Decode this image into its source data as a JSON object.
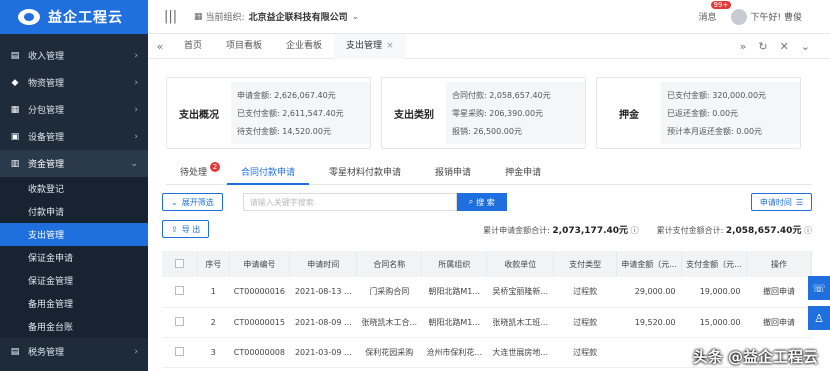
{
  "app": {
    "logo": "益企工程云"
  },
  "sidebar": {
    "groups_top": [
      {
        "label": "收入管理"
      },
      {
        "label": "物资管理"
      },
      {
        "label": "分包管理"
      },
      {
        "label": "设备管理"
      }
    ],
    "active_group": {
      "label": "资金管理"
    },
    "subitems": [
      {
        "label": "收款登记"
      },
      {
        "label": "付款申请"
      },
      {
        "label": "支出管理"
      },
      {
        "label": "保证金申请"
      },
      {
        "label": "保证金管理"
      },
      {
        "label": "备用金管理"
      },
      {
        "label": "备用金台账"
      }
    ],
    "groups_bottom": [
      {
        "label": "税务管理"
      }
    ]
  },
  "topbar": {
    "org_label": "当前组织:",
    "org_name": "北京益企联科技有限公司",
    "msg_label": "消息",
    "msg_badge": "99+",
    "greeting": "下午好! 曹俊"
  },
  "page_tabs": [
    {
      "label": "首页"
    },
    {
      "label": "项目看板"
    },
    {
      "label": "企业看板"
    },
    {
      "label": "支出管理"
    }
  ],
  "cards": [
    {
      "title": "支出概况",
      "lines": [
        "申请金额: 2,626,067.40元",
        "已支付金额: 2,611,547.40元",
        "待支付金额: 14,520.00元"
      ]
    },
    {
      "title": "支出类别",
      "lines": [
        "合同付款: 2,058,657.40元",
        "零星采购: 206,390.00元",
        "报销: 26,500.00元"
      ]
    },
    {
      "title": "押金",
      "lines": [
        "已支付金额: 320,000.00元",
        "已返还金额: 0.00元",
        "预计本月返还金额: 0.00元"
      ]
    }
  ],
  "filter_tabs": [
    {
      "label": "待处理",
      "badge": "2"
    },
    {
      "label": "合同付款申请"
    },
    {
      "label": "零星材料付款申请"
    },
    {
      "label": "报销申请"
    },
    {
      "label": "押金申请"
    }
  ],
  "toolbar": {
    "expand_label": "展开筛选",
    "search_placeholder": "请输入关键字搜索",
    "search_label": "搜 索",
    "time_label": "申请时间",
    "export_label": "导 出",
    "sum_apply_label": "累计申请金额合计:",
    "sum_apply_value": "2,073,177.40元",
    "sum_paid_label": "累计支付金额合计:",
    "sum_paid_value": "2,058,657.40元"
  },
  "table": {
    "headers": [
      "序号",
      "申请编号",
      "申请时间",
      "合同名称",
      "所属组织",
      "收款单位",
      "支付类型",
      "申请金额（元...",
      "支付金额（元...",
      "操作"
    ],
    "rows": [
      [
        "1",
        "CT00000016",
        "2021-08-13 ...",
        "门采购合同",
        "朝阳北路M1...",
        "吴桥宝丽隆新...",
        "过程款",
        "29,000.00",
        "19,000.00",
        "撤回申请"
      ],
      [
        "2",
        "CT00000015",
        "2021-08-09 ...",
        "张晓凯木工合...",
        "朝阳北路M1...",
        "张晓凯木工班...",
        "过程款",
        "19,520.00",
        "15,000.00",
        "撤回申请"
      ],
      [
        "3",
        "CT00000008",
        "2021-03-09 ...",
        "保利花园采购",
        "沧州市保利花...",
        "大连世展房地...",
        "过程款",
        "",
        "",
        ""
      ]
    ]
  },
  "watermark": "头条 @益企工程云"
}
